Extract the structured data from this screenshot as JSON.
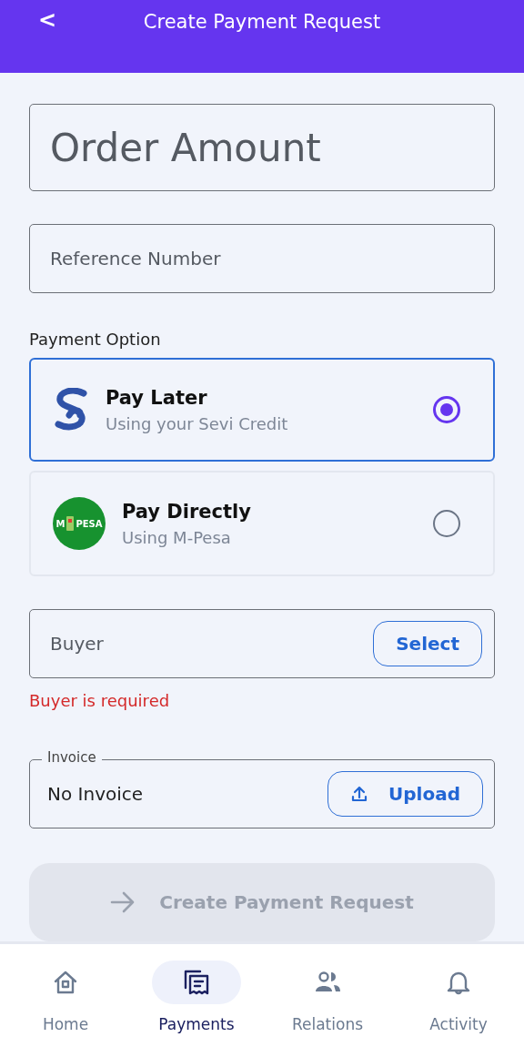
{
  "header": {
    "back": "<",
    "title": "Create Payment Request"
  },
  "order_amount": {
    "placeholder": "Order Amount"
  },
  "reference": {
    "placeholder": "Reference Number"
  },
  "payment_option": {
    "label": "Payment Option",
    "options": [
      {
        "kind": "sevi",
        "title": "Pay Later",
        "subtitle": "Using your Sevi Credit",
        "selected": true
      },
      {
        "kind": "mpesa",
        "title": "Pay Directly",
        "subtitle": "Using M-Pesa",
        "selected": false,
        "logo_text": [
          "M",
          "PESA"
        ]
      }
    ]
  },
  "buyer": {
    "placeholder": "Buyer",
    "button": "Select",
    "error": "Buyer is required"
  },
  "invoice": {
    "label": "Invoice",
    "value": "No Invoice",
    "button": "Upload"
  },
  "submit": {
    "label": "Create Payment Request",
    "disabled": true
  },
  "nav": [
    {
      "kind": "home",
      "label": "Home",
      "selected": false
    },
    {
      "kind": "payments",
      "label": "Payments",
      "selected": true
    },
    {
      "kind": "relations",
      "label": "Relations",
      "selected": false
    },
    {
      "kind": "activity",
      "label": "Activity",
      "selected": false
    }
  ]
}
